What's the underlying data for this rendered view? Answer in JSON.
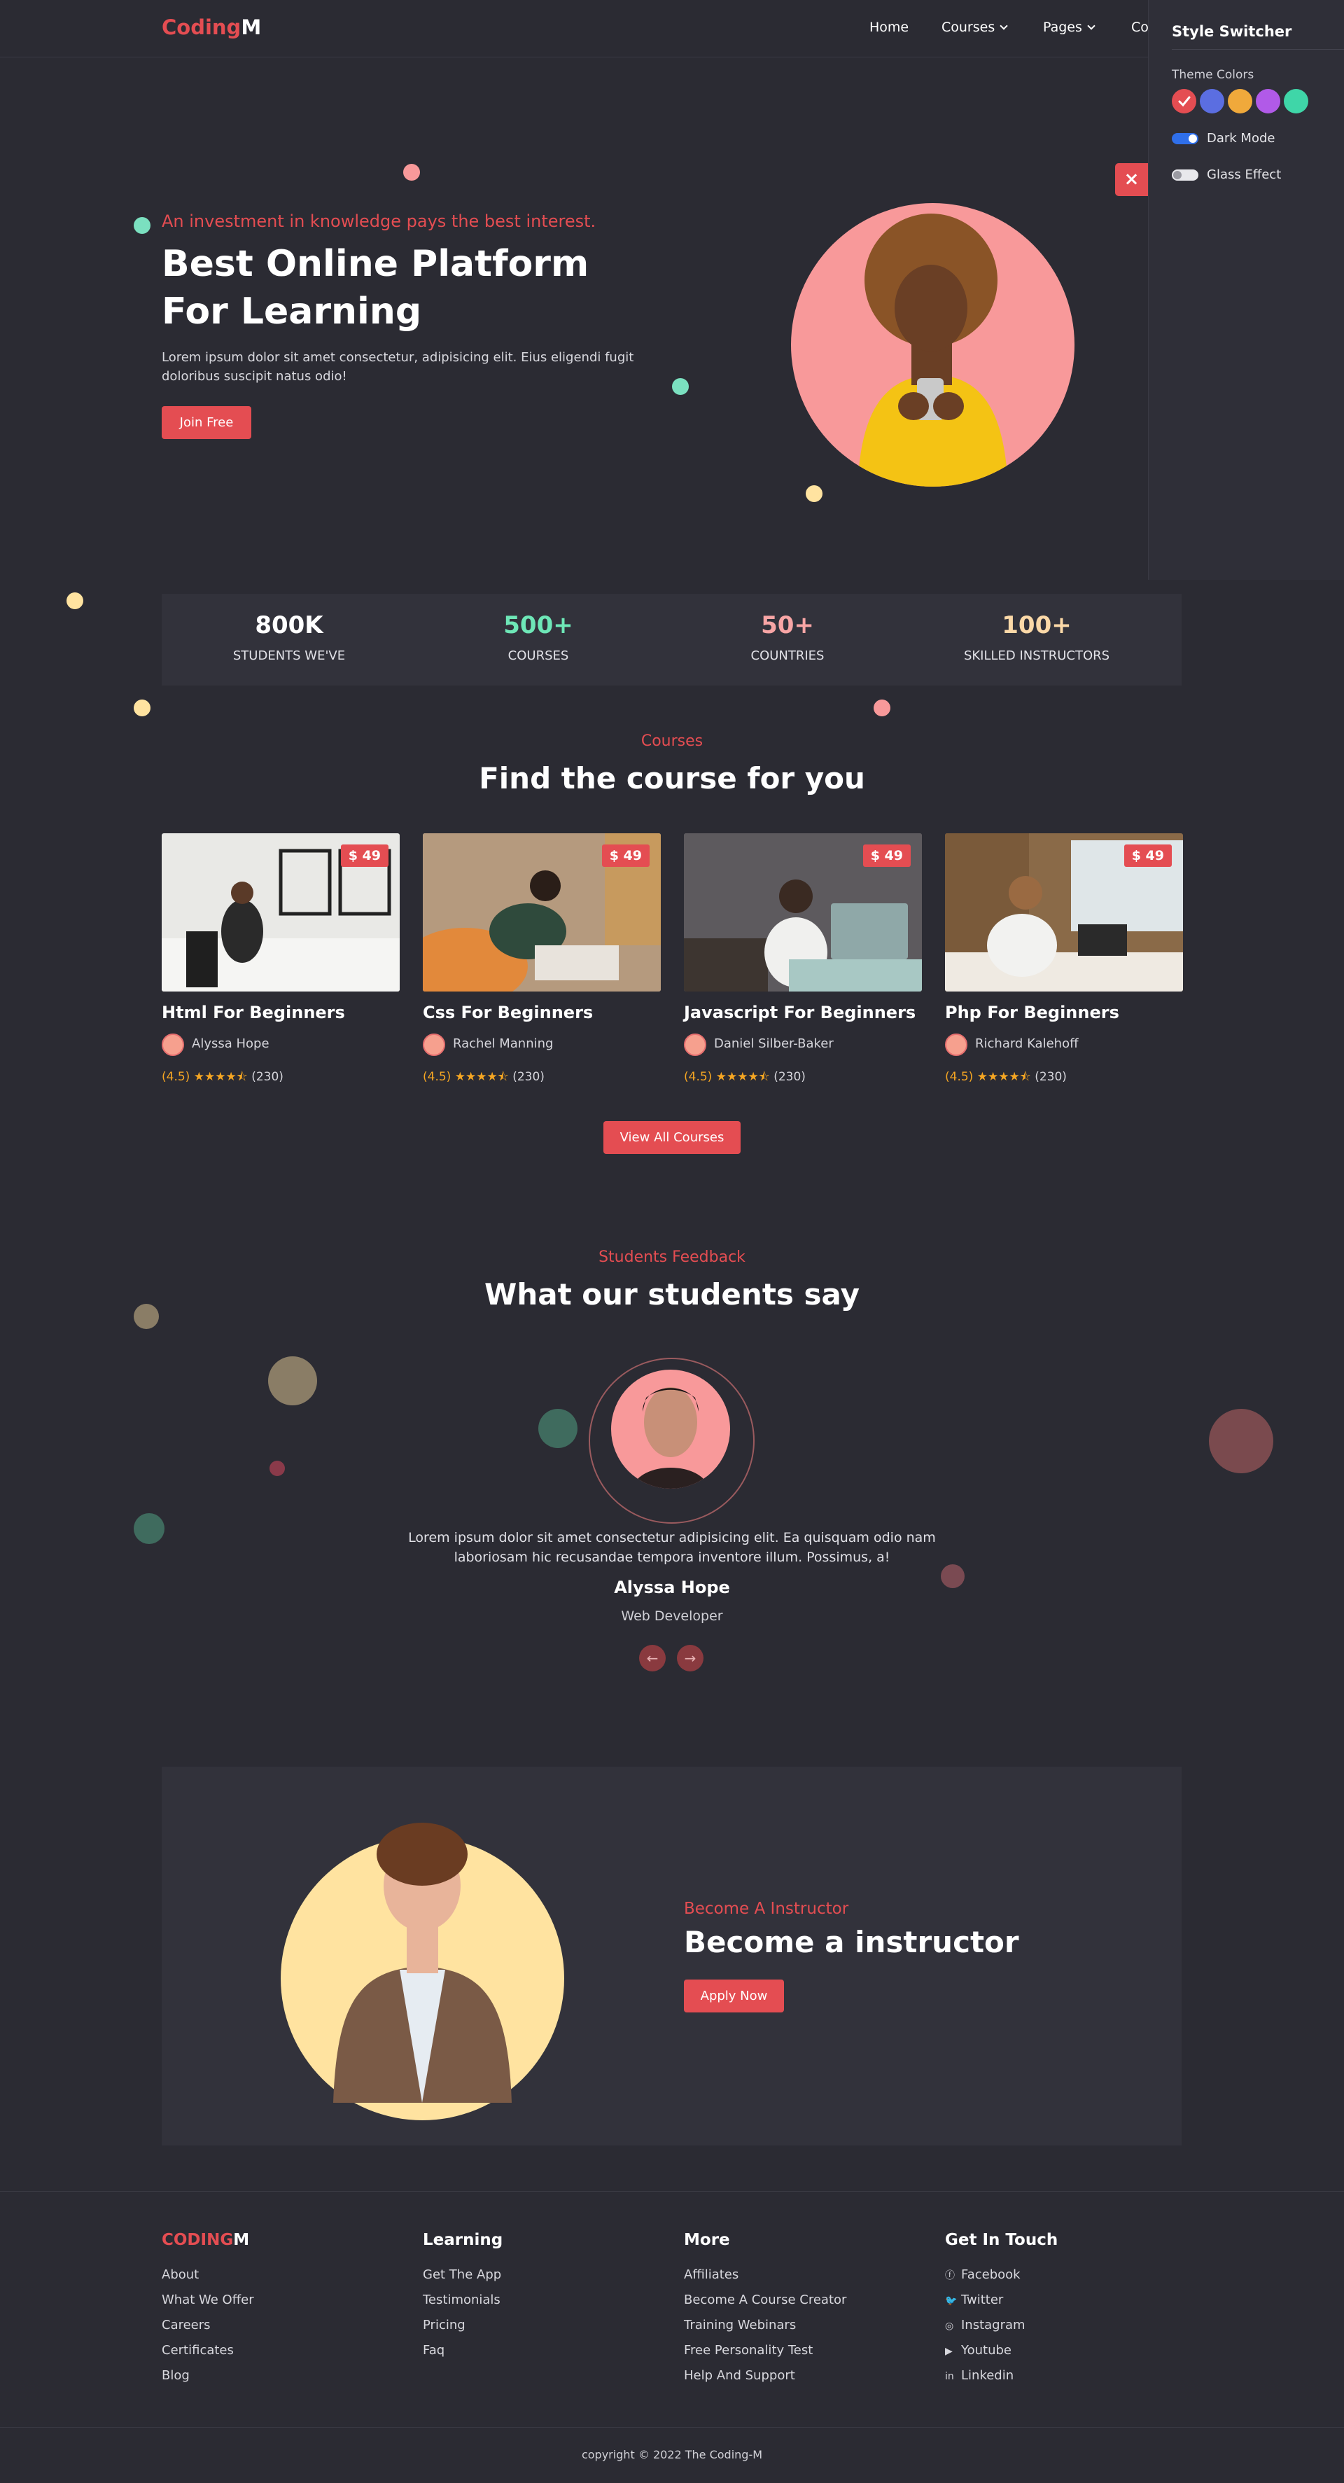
{
  "header": {
    "logo_part1": "Coding",
    "logo_part2": "M",
    "nav": [
      {
        "label": "Home",
        "dropdown": false
      },
      {
        "label": "Courses",
        "dropdown": true
      },
      {
        "label": "Pages",
        "dropdown": true
      },
      {
        "label": "Co",
        "dropdown": false
      }
    ]
  },
  "style_switcher": {
    "title": "Style Switcher",
    "theme_colors_label": "Theme Colors",
    "colors": [
      "#e44d52",
      "#5b6ee1",
      "#f0a93b",
      "#b15ae8",
      "#3fd6a8"
    ],
    "selected_color_index": 0,
    "dark_mode_label": "Dark Mode",
    "dark_mode_on": true,
    "glass_effect_label": "Glass Effect",
    "glass_effect_on": false,
    "close_icon": "×"
  },
  "hero": {
    "eyebrow": "An investment in knowledge pays the best interest.",
    "title": "Best Online Platform For Learning",
    "description": "Lorem ipsum dolor sit amet consectetur, adipisicing elit. Eius eligendi fugit doloribus suscipit natus odio!",
    "cta": "Join Free"
  },
  "stats": [
    {
      "value": "800K",
      "label": "STUDENTS WE'VE",
      "color": "#ffffff"
    },
    {
      "value": "500+",
      "label": "COURSES",
      "color": "#6ee7b7"
    },
    {
      "value": "50+",
      "label": "COUNTRIES",
      "color": "#f8a5a5"
    },
    {
      "value": "100+",
      "label": "SKILLED INSTRUCTORS",
      "color": "#fcd9a8"
    }
  ],
  "courses": {
    "eyebrow": "Courses",
    "title": "Find the course for you",
    "items": [
      {
        "title": "Html For Beginners",
        "price": "$ 49",
        "author": "Alyssa Hope",
        "rating": "(4.5)",
        "count": "(230)"
      },
      {
        "title": "Css For Beginners",
        "price": "$ 49",
        "author": "Rachel Manning",
        "rating": "(4.5)",
        "count": "(230)"
      },
      {
        "title": "Javascript For Beginners",
        "price": "$ 49",
        "author": "Daniel Silber-Baker",
        "rating": "(4.5)",
        "count": "(230)"
      },
      {
        "title": "Php For Beginners",
        "price": "$ 49",
        "author": "Richard Kalehoff",
        "rating": "(4.5)",
        "count": "(230)"
      }
    ],
    "view_all": "View All Courses"
  },
  "testimonials": {
    "eyebrow": "Students Feedback",
    "title": "What our students say",
    "quote": "Lorem ipsum dolor sit amet consectetur adipisicing elit. Ea quisquam odio nam laboriosam hic recusandae tempora inventore illum. Possimus, a!",
    "name": "Alyssa Hope",
    "role": "Web Developer",
    "prev_icon": "←",
    "next_icon": "→"
  },
  "instructor": {
    "eyebrow": "Become A Instructor",
    "title": "Become a instructor",
    "cta": "Apply Now"
  },
  "footer": {
    "logo_part1": "CODING",
    "logo_part2": "M",
    "brand_links": [
      "About",
      "What We Offer",
      "Careers",
      "Certificates",
      "Blog"
    ],
    "learning_title": "Learning",
    "learning_links": [
      "Get The App",
      "Testimonials",
      "Pricing",
      "Faq"
    ],
    "more_title": "More",
    "more_links": [
      "Affiliates",
      "Become A Course Creator",
      "Training Webinars",
      "Free Personality Test",
      "Help And Support"
    ],
    "contact_title": "Get In Touch",
    "social_links": [
      {
        "label": "Facebook",
        "icon": "facebook-icon"
      },
      {
        "label": "Twitter",
        "icon": "twitter-icon"
      },
      {
        "label": "Instagram",
        "icon": "instagram-icon"
      },
      {
        "label": "Youtube",
        "icon": "youtube-icon"
      },
      {
        "label": "Linkedin",
        "icon": "linkedin-icon"
      }
    ],
    "copyright": "copyright © 2022 The Coding-M"
  }
}
